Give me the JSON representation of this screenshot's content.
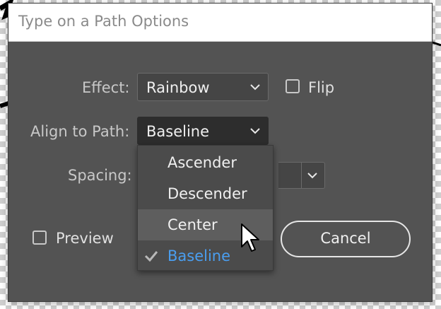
{
  "dialog": {
    "title": "Type on a Path Options"
  },
  "effect": {
    "label": "Effect:",
    "value": "Rainbow"
  },
  "flip": {
    "label": "Flip",
    "checked": false
  },
  "align": {
    "label": "Align to Path:",
    "value": "Baseline",
    "options": [
      "Ascender",
      "Descender",
      "Center",
      "Baseline"
    ],
    "hovered": "Center",
    "selected": "Baseline"
  },
  "spacing": {
    "label": "Spacing:"
  },
  "preview": {
    "label": "Preview",
    "checked": false
  },
  "buttons": {
    "cancel": "Cancel"
  },
  "colors": {
    "dialog_bg": "#535353",
    "selected_item": "#4a9ef0",
    "hover_item": "#5e5e5e"
  },
  "icons": [
    "chevron-down-icon",
    "checkmark-icon",
    "mouse-pointer-icon"
  ]
}
